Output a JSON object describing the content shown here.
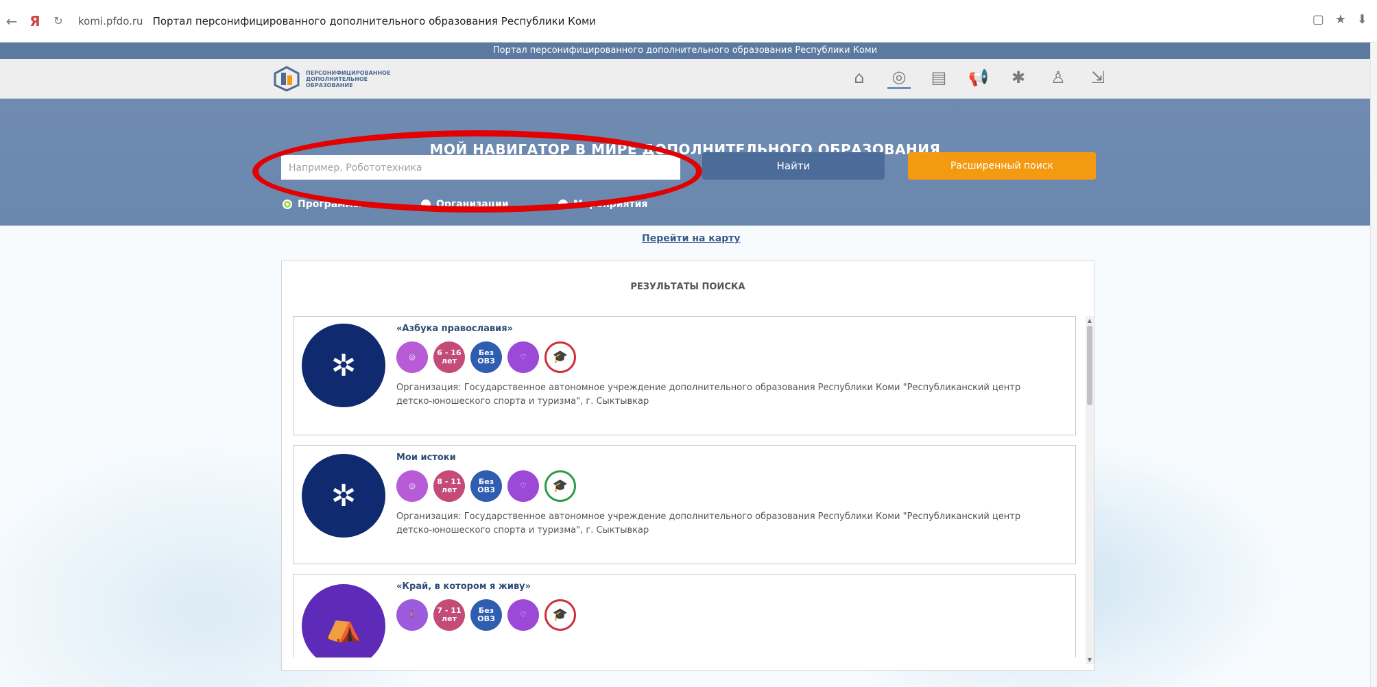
{
  "browser": {
    "url": "komi.pfdo.ru",
    "title": "Портал персонифицированного дополнительного образования Республики Коми"
  },
  "strip_text": "Портал персонифицированного дополнительного образования Республики Коми",
  "logo": {
    "lines": [
      "ПЕРСОНИФИЦИРОВАННОЕ",
      "ДОПОЛНИТЕЛЬНОЕ",
      "ОБРАЗОВАНИЕ"
    ]
  },
  "hero": {
    "title": "МОЙ НАВИГАТОР В МИРЕ ДОПОЛНИТЕЛЬНОГО ОБРАЗОВАНИЯ",
    "search_placeholder": "Например, Робототехника",
    "search_button": "Найти",
    "advanced_button": "Расширенный поиск",
    "radios": [
      "Программы",
      "Организации",
      "Мероприятия"
    ]
  },
  "map_link": "Перейти на карту",
  "results": {
    "title": "РЕЗУЛЬТАТЫ ПОИСКА",
    "items": [
      {
        "name": "«Азбука православия»",
        "age": "6 - 16 лет",
        "ovz": "Без ОВЗ",
        "org_line1": "Организация: Государственное автономное учреждение дополнительного образования Республики Коми \"Республиканский центр",
        "org_line2": "детско-юношеского спорта и туризма\", г. Сыктывкар"
      },
      {
        "name": "Мои истоки",
        "age": "8 - 11 лет",
        "ovz": "Без ОВЗ",
        "org_line1": "Организация: Государственное автономное учреждение дополнительного образования Республики Коми \"Республиканский центр",
        "org_line2": "детско-юношеского спорта и туризма\", г. Сыктывкар"
      },
      {
        "name": "«Край, в котором я живу»",
        "age": "7 - 11 лет",
        "ovz": "Без ОВЗ"
      }
    ]
  },
  "colors": {
    "accent": "#5c7aa0",
    "hero": "#6f8bb2",
    "search_btn": "#4b6b98",
    "advanced_btn": "#f39a11",
    "highlight": "#e30000"
  }
}
